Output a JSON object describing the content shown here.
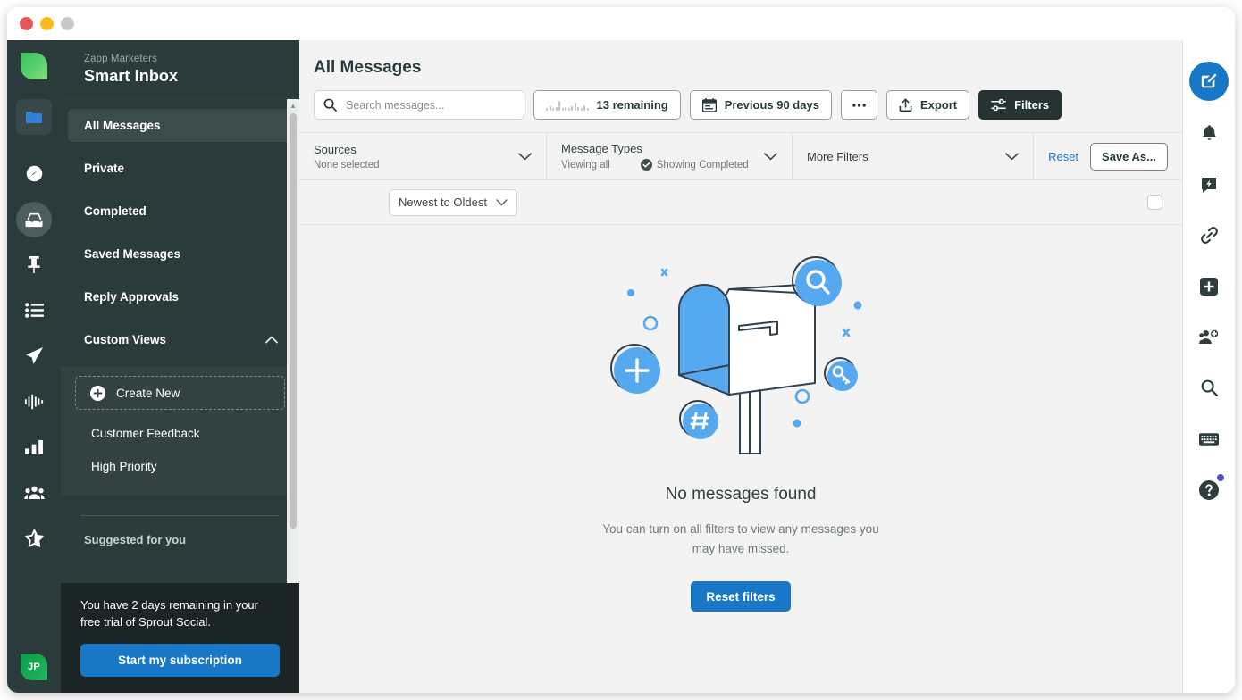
{
  "window": {
    "traffic_lights": [
      "close",
      "minimize",
      "maximize"
    ]
  },
  "left_rail": {
    "logo": "sprout-leaf-logo",
    "folder_icon": "folder-icon",
    "items": [
      {
        "name": "dashboard",
        "icon": "speedometer-icon"
      },
      {
        "name": "inbox",
        "icon": "inbox-icon",
        "active": true
      },
      {
        "name": "publishing",
        "icon": "pin-icon"
      },
      {
        "name": "tasks",
        "icon": "list-icon"
      },
      {
        "name": "compose",
        "icon": "paper-plane-icon"
      },
      {
        "name": "listening",
        "icon": "waveform-icon"
      },
      {
        "name": "reports",
        "icon": "bar-chart-icon"
      },
      {
        "name": "audience",
        "icon": "people-icon"
      },
      {
        "name": "reviews",
        "icon": "star-icon"
      }
    ],
    "avatar_initials": "JP"
  },
  "nav": {
    "org": "Zapp Marketers",
    "title": "Smart Inbox",
    "items": [
      {
        "label": "All Messages",
        "selected": true
      },
      {
        "label": "Private",
        "selected": false
      },
      {
        "label": "Completed",
        "selected": false
      },
      {
        "label": "Saved Messages",
        "selected": false
      },
      {
        "label": "Reply Approvals",
        "selected": false
      }
    ],
    "custom_views": {
      "header": "Custom Views",
      "collapse_icon": "chevron-up-icon",
      "create_new": "Create New",
      "create_new_icon": "plus-circle-icon",
      "views": [
        {
          "label": "Customer Feedback"
        },
        {
          "label": "High Priority"
        }
      ]
    },
    "suggested_label": "Suggested for you"
  },
  "trial": {
    "message": "You have 2 days remaining in your free trial of Sprout Social.",
    "button": "Start my subscription"
  },
  "main": {
    "page_title": "All Messages",
    "search": {
      "icon": "search-icon",
      "placeholder": "Search messages...",
      "value": ""
    },
    "toolbar": [
      {
        "name": "remaining-counter",
        "label": "13 remaining",
        "icon": "sparkline-icon",
        "style": "light"
      },
      {
        "name": "date-range",
        "label": "Previous 90 days",
        "icon": "calendar-icon",
        "style": "light"
      },
      {
        "name": "more-options",
        "label": "",
        "icon": "ellipsis-icon",
        "style": "light"
      },
      {
        "name": "export",
        "label": "Export",
        "icon": "export-icon",
        "style": "light"
      },
      {
        "name": "filters",
        "label": "Filters",
        "icon": "sliders-icon",
        "style": "dark"
      }
    ],
    "filters": {
      "sources": {
        "label": "Sources",
        "value": "None selected",
        "chevron": "chevron-down-icon"
      },
      "message_types": {
        "label": "Message Types",
        "value": "Viewing all",
        "chip": "Showing Completed",
        "chip_icon": "check-circle-icon",
        "chevron": "chevron-down-icon"
      },
      "more_filters": {
        "label": "More Filters",
        "chevron": "chevron-down-icon"
      },
      "reset": "Reset",
      "save_as": "Save As..."
    },
    "sort": {
      "value": "Newest to Oldest",
      "chevron": "chevron-down-icon",
      "select_all_checkbox": "unchecked"
    },
    "empty_state": {
      "illustration": "mailbox-illustration",
      "title": "No messages found",
      "subtitle": "You can turn on all filters to view any messages you may have missed.",
      "button": "Reset filters"
    }
  },
  "right_rail": {
    "items": [
      {
        "name": "compose",
        "icon": "compose-pencil-icon",
        "primary": true
      },
      {
        "name": "notifications",
        "icon": "bell-icon"
      },
      {
        "name": "feedback",
        "icon": "chat-bolt-icon"
      },
      {
        "name": "links",
        "icon": "link-icon"
      },
      {
        "name": "add",
        "icon": "plus-square-icon"
      },
      {
        "name": "team",
        "icon": "people-add-icon"
      },
      {
        "name": "search",
        "icon": "search-icon"
      },
      {
        "name": "shortcuts",
        "icon": "keyboard-icon"
      },
      {
        "name": "help",
        "icon": "question-circle-icon",
        "badge": true
      }
    ]
  },
  "colors": {
    "accent_blue": "#1877c6",
    "nav_dark": "#2b3a3a",
    "nav_selected": "#3c4c4b",
    "trial_bg": "#1b2525",
    "page_bg": "#f3f3f3",
    "illustration_blue": "#56a9ef",
    "badge_purple": "#5a4fcf",
    "leaf_green": "#25b55c"
  }
}
